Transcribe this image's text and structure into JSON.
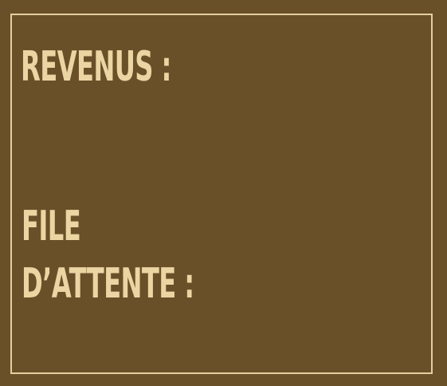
{
  "panel": {
    "revenue_label": "REVENUS :",
    "queue_label_line1": "FILE",
    "queue_label_line2": "D’ATTENTE :"
  },
  "colors": {
    "background": "#6a5028",
    "text": "#ebd5a3",
    "border": "#e4cf9f"
  }
}
